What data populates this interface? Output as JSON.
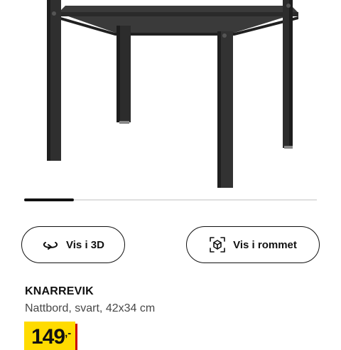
{
  "product_image": {
    "alt": ""
  },
  "carousel": {
    "progress": 0.17
  },
  "actions": {
    "view_3d_label": "Vis i 3D",
    "view_in_room_label": "Vis i rommet"
  },
  "product": {
    "name": "KNARREVIK",
    "description": "Nattbord, svart, 42x34 cm",
    "price": "149",
    "price_suffix": ",-"
  },
  "colors": {
    "price_tag": "#ffdb00",
    "price_accent": "#cc0008"
  }
}
